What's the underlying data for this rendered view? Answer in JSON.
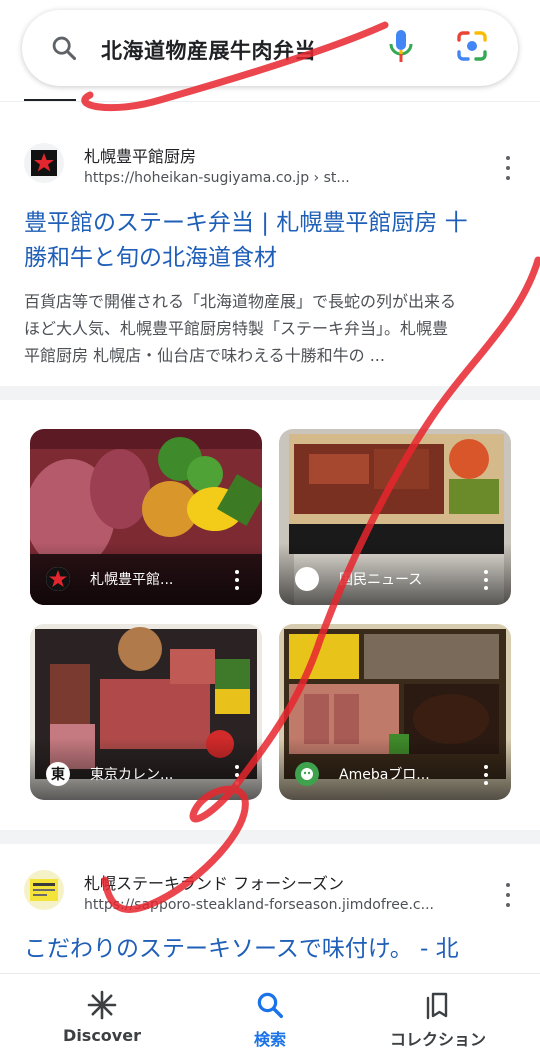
{
  "search": {
    "query": "北海道物産展牛肉弁当"
  },
  "results": [
    {
      "site_name": "札幌豊平館厨房",
      "url": "https://hoheikan-sugiyama.co.jp › st...",
      "title_line1": "豊平館のステーキ弁当 | 札幌豊平館厨房 十",
      "title_line2": "勝和牛と旬の北海道食材",
      "snippet_line1": "百貨店等で開催される「北海道物産展」で長蛇の列が出来る",
      "snippet_line2": "ほど大人気、札幌豊平館厨房特製「ステーキ弁当」。札幌豊",
      "snippet_line3": "平館厨房 札幌店・仙台店で味わえる十勝和牛の ..."
    },
    {
      "site_name": "札幌ステーキランド フォーシーズン",
      "url": "https://sapporo-steakland-forseason.jimdofree.c...",
      "title_line1": "こだわりのステーキソースで味付け。 - 北"
    }
  ],
  "images": [
    {
      "label": "札幌豊平館...",
      "favicon": "red-star-icon"
    },
    {
      "label": "国民ニュース",
      "favicon": "white-circle-icon"
    },
    {
      "label": "東京カレン...",
      "favicon": "higashi-kanji-icon"
    },
    {
      "label": "Amebaブロ...",
      "favicon": "ameba-icon"
    }
  ],
  "nav": {
    "discover": "Discover",
    "search": "検索",
    "collections": "コレクション"
  },
  "colors": {
    "link": "#1f5fb8",
    "accent": "#1a73e8",
    "scribble": "#e8262e"
  }
}
